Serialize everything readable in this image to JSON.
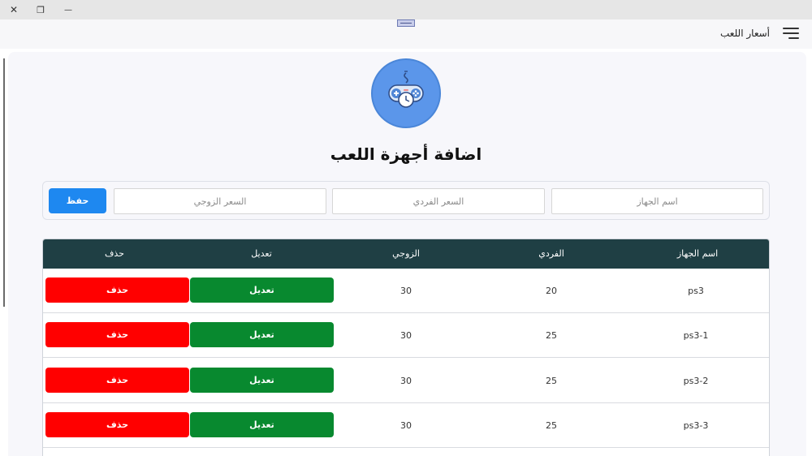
{
  "window": {
    "controls": [
      {
        "name": "close-window-button",
        "glyph": "✕"
      },
      {
        "name": "restore-window-button",
        "glyph": "❐"
      },
      {
        "name": "minimize-window-button",
        "glyph": "—"
      }
    ]
  },
  "appbar": {
    "title": "أسعار اللعب",
    "menu_icon": "hamburger-menu-icon"
  },
  "logo": {
    "icon": "gamepad-clock-icon",
    "colors": {
      "circle": "#5b96ea",
      "pad": "#d7e6f7",
      "accent": "#3a6fc4"
    }
  },
  "page": {
    "title": "اضافة أجهزة اللعب"
  },
  "form": {
    "device_name_placeholder": "اسم الجهاز",
    "single_price_placeholder": "السعر الفردي",
    "double_price_placeholder": "السعر الزوجي",
    "device_name_value": "",
    "single_price_value": "",
    "double_price_value": "",
    "save_label": "حفظ"
  },
  "table": {
    "headers": {
      "device_name": "اسم الجهاز",
      "single": "الفردي",
      "double": "الزوجي",
      "edit": "تعديل",
      "delete": "حذف"
    },
    "rows": [
      {
        "device_name": "ps3",
        "single": "20",
        "double": "30",
        "edit_label": "تعديل",
        "delete_label": "حذف"
      },
      {
        "device_name": "ps3-1",
        "single": "25",
        "double": "30",
        "edit_label": "تعديل",
        "delete_label": "حذف"
      },
      {
        "device_name": "ps3-2",
        "single": "25",
        "double": "30",
        "edit_label": "تعديل",
        "delete_label": "حذف"
      },
      {
        "device_name": "ps3-3",
        "single": "25",
        "double": "30",
        "edit_label": "تعديل",
        "delete_label": "حذف"
      }
    ]
  },
  "colors": {
    "header_bg": "#1f3f44",
    "save_button": "#1e88f0",
    "edit_button": "#08892f",
    "delete_button": "#ff0000"
  }
}
